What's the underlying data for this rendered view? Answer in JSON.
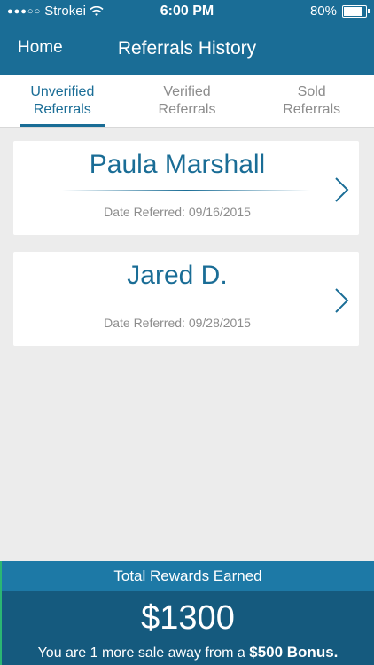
{
  "status_bar": {
    "carrier": "Strokei",
    "time": "6:00 PM",
    "battery": "80%"
  },
  "nav": {
    "back_label": "Home",
    "title": "Referrals History"
  },
  "tabs": [
    {
      "line1": "Unverified",
      "line2": "Referrals",
      "active": true
    },
    {
      "line1": "Verified",
      "line2": "Referrals",
      "active": false
    },
    {
      "line1": "Sold",
      "line2": "Referrals",
      "active": false
    }
  ],
  "referrals": [
    {
      "name": "Paula Marshall",
      "date": "Date Referred: 09/16/2015"
    },
    {
      "name": "Jared D.",
      "date": "Date Referred: 09/28/2015"
    }
  ],
  "footer": {
    "header": "Total Rewards Earned",
    "amount": "$1300",
    "message_prefix": "You are 1 more sale away from a ",
    "message_bonus": "$500 Bonus."
  },
  "colors": {
    "primary": "#1a6d96",
    "footer_dark": "#155a7e",
    "accent_green": "#2bb673"
  }
}
